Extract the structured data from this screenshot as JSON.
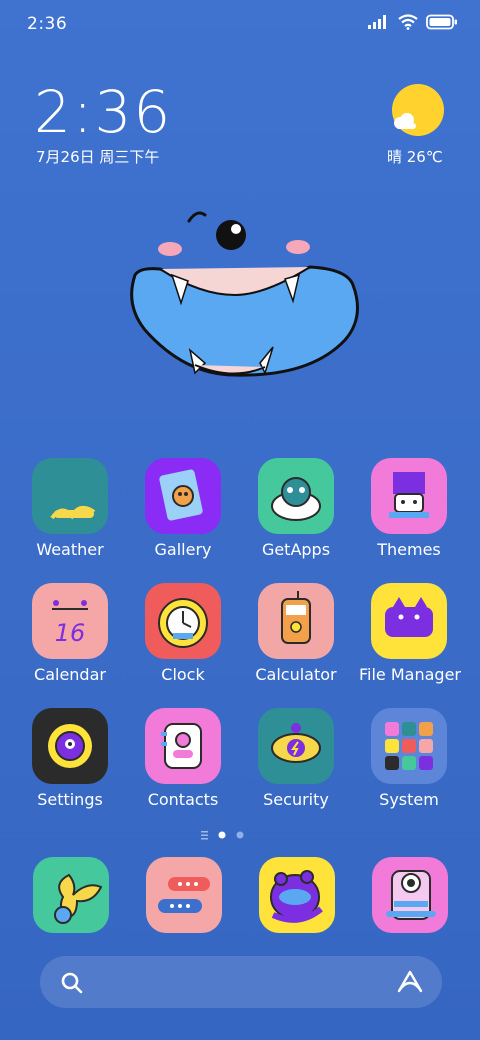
{
  "status": {
    "time": "2:36",
    "icons": [
      "signal-icon",
      "wifi-icon",
      "battery-icon"
    ]
  },
  "widget": {
    "time": "2:36",
    "date": "7月26日 周三下午",
    "weather": "晴 26℃"
  },
  "apps": [
    {
      "label": "Weather",
      "color": "#2f8f96"
    },
    {
      "label": "Gallery",
      "color": "#8a2cf5"
    },
    {
      "label": "GetApps",
      "color": "#45c99c"
    },
    {
      "label": "Themes",
      "color": "#f27bd9"
    },
    {
      "label": "Calendar",
      "color": "#f5a7a7"
    },
    {
      "label": "Clock",
      "color": "#f05c5c"
    },
    {
      "label": "Calculator",
      "color": "#f2a6a6"
    },
    {
      "label": "File Manager",
      "color": "#ffe23a"
    },
    {
      "label": "Settings",
      "color": "#2b2b2b"
    },
    {
      "label": "Contacts",
      "color": "#f27bd9"
    },
    {
      "label": "Security",
      "color": "#2f8f96"
    },
    {
      "label": "System",
      "color": "#5d86d8"
    }
  ],
  "calendar_icon_number": "16",
  "dock": [
    {
      "name": "dock-app-phone",
      "color": "#45c99c"
    },
    {
      "name": "dock-app-messages",
      "color": "#f5a7a7"
    },
    {
      "name": "dock-app-browser",
      "color": "#ffe23a"
    },
    {
      "name": "dock-app-camera",
      "color": "#f27bd9"
    }
  ],
  "colors": {
    "background": "#3d70cc",
    "sun": "#ffd22e",
    "monster_mouth": "#5aa8f2"
  }
}
